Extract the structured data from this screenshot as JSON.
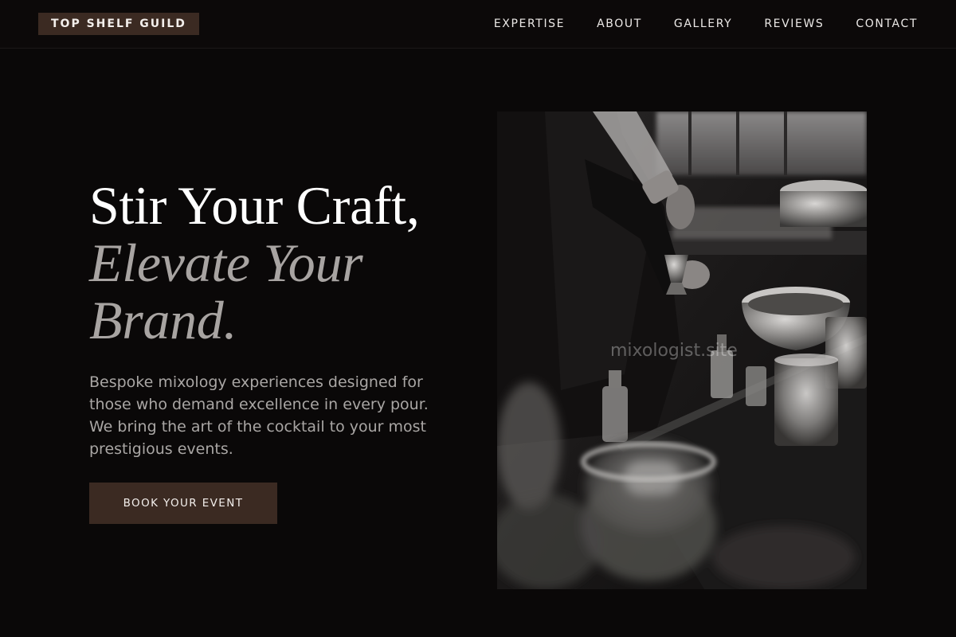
{
  "brand": {
    "logo_text": "TOP SHELF GUILD"
  },
  "nav": {
    "items": [
      {
        "label": "EXPERTISE"
      },
      {
        "label": "ABOUT"
      },
      {
        "label": "GALLERY"
      },
      {
        "label": "REVIEWS"
      },
      {
        "label": "CONTACT"
      }
    ]
  },
  "hero": {
    "title_line1": "Stir Your Craft,",
    "title_line2": "Elevate Your",
    "title_line3": "Brand.",
    "description": "Bespoke mixology experiences designed for those who demand excellence in every pour. We bring the art of the cocktail to your most prestigious events.",
    "cta_label": "BOOK YOUR EVENT",
    "image_watermark": "mixologist.site"
  },
  "colors": {
    "background": "#0a0808",
    "accent": "#3b2a22",
    "muted_text": "#a9a6a4"
  }
}
